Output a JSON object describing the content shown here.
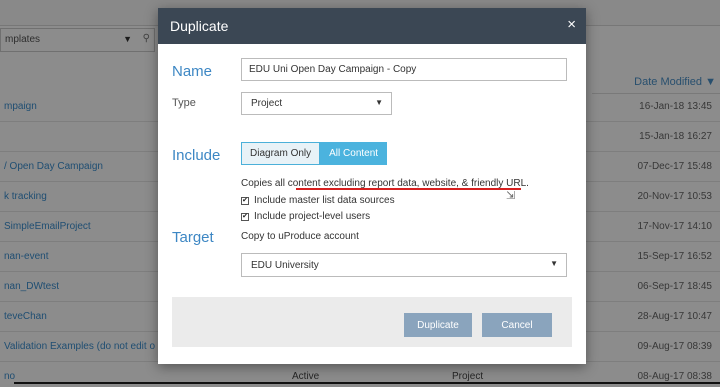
{
  "background": {
    "filter": {
      "label": "mplates",
      "caret": "▼",
      "search_icon": "⚲"
    },
    "column_header": {
      "date_modified": "Date Modified",
      "sort_icon": "▼"
    },
    "rows": [
      {
        "name": "mpaign",
        "status": "",
        "kind": "",
        "date": "16-Jan-18 13:45"
      },
      {
        "name": "",
        "status": "",
        "kind": "",
        "date": "15-Jan-18 16:27"
      },
      {
        "name": "/ Open Day Campaign",
        "status": "",
        "kind": "",
        "date": "07-Dec-17 15:48"
      },
      {
        "name": "k tracking",
        "status": "",
        "kind": "",
        "date": "20-Nov-17 10:53"
      },
      {
        "name": "SimpleEmailProject",
        "status": "",
        "kind": "",
        "date": "17-Nov-17 14:10"
      },
      {
        "name": "nan-event",
        "status": "",
        "kind": "",
        "date": "15-Sep-17 16:52"
      },
      {
        "name": "nan_DWtest",
        "status": "",
        "kind": "",
        "date": "06-Sep-17 18:45"
      },
      {
        "name": "teveChan",
        "status": "",
        "kind": "",
        "date": "28-Aug-17 10:47"
      },
      {
        "name": "Validation Examples (do not edit o",
        "status": "",
        "kind": "",
        "date": "09-Aug-17 08:39"
      },
      {
        "name": "no",
        "status": "Active",
        "kind": "Project",
        "date": "08-Aug-17 08:38"
      }
    ]
  },
  "modal": {
    "title": "Duplicate",
    "close_glyph": "×",
    "name_section": "Name",
    "name_value": "EDU Uni Open Day Campaign - Copy",
    "type_label": "Type",
    "type_value": "Project",
    "select_arrow": "▼",
    "include_section": "Include",
    "segment": {
      "diagram_only": "Diagram Only",
      "all_content": "All Content"
    },
    "description": "Copies all content excluding report data, website, & friendly URL.",
    "checkbox_master": "Include master list data sources",
    "checkbox_users": "Include project-level users",
    "checkmark": "✔",
    "target_section": "Target",
    "target_label": "Copy to uProduce account",
    "target_value": "EDU University",
    "cursor_glyph": "⇲",
    "buttons": {
      "duplicate": "Duplicate",
      "cancel": "Cancel"
    }
  },
  "colors": {
    "header_bg": "#3b4754",
    "accent_blue": "#3d87c4",
    "segment_active": "#4bb3de",
    "button_bg": "#8aa4bd",
    "annotation_red": "#d62020"
  }
}
